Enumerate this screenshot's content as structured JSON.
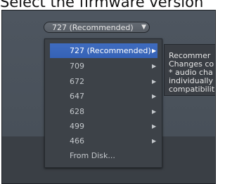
{
  "page_heading": "Select the firmware version",
  "firmware_combo": {
    "selected_value": "727 (Recommended)",
    "arrow_icon": "triangle-down"
  },
  "firmware_menu": {
    "items": [
      {
        "label": "727 (Recommended)",
        "has_submenu": true,
        "selected": true
      },
      {
        "label": "709",
        "has_submenu": true,
        "selected": false
      },
      {
        "label": "672",
        "has_submenu": true,
        "selected": false
      },
      {
        "label": "647",
        "has_submenu": true,
        "selected": false
      },
      {
        "label": "628",
        "has_submenu": true,
        "selected": false
      },
      {
        "label": "499",
        "has_submenu": true,
        "selected": false
      },
      {
        "label": "466",
        "has_submenu": true,
        "selected": false
      },
      {
        "label": "From Disk...",
        "has_submenu": false,
        "selected": false
      }
    ]
  },
  "tooltip": {
    "lines": [
      "Recommer",
      "Changes co",
      "* audio cha",
      "individually",
      "compatibilit"
    ]
  },
  "colors": {
    "selection": "#3a68bc",
    "menu_background": "#3d4248",
    "window_background": "#4b525b"
  }
}
